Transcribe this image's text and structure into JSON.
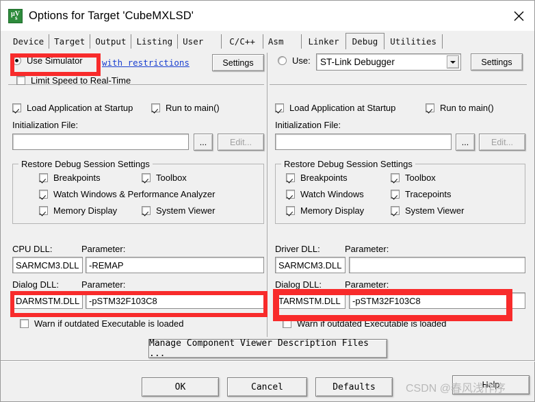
{
  "window": {
    "title": "Options for Target 'CubeMXLSD'",
    "icon": "keil-uvision-icon",
    "close_icon": "close-icon"
  },
  "tabs": [
    {
      "label": "Device",
      "active": false
    },
    {
      "label": "Target",
      "active": false
    },
    {
      "label": "Output",
      "active": false
    },
    {
      "label": "Listing",
      "active": false
    },
    {
      "label": "User",
      "active": false
    },
    {
      "label": "C/C++",
      "active": false
    },
    {
      "label": "Asm",
      "active": false
    },
    {
      "label": "Linker",
      "active": false
    },
    {
      "label": "Debug",
      "active": true
    },
    {
      "label": "Utilities",
      "active": false
    }
  ],
  "left": {
    "use_simulator_label": "Use Simulator",
    "use_simulator_checked": true,
    "with_restrictions_link": "with restrictions",
    "settings_button": "Settings",
    "limit_speed_label": "Limit Speed to Real-Time",
    "limit_speed_checked": false,
    "load_app_label": "Load Application at Startup",
    "load_app_checked": true,
    "run_to_main_label": "Run to main()",
    "run_to_main_checked": true,
    "init_file_label": "Initialization File:",
    "init_file_value": "",
    "browse_button": "...",
    "edit_button": "Edit...",
    "restore_group_title": "Restore Debug Session Settings",
    "restore_items": [
      {
        "label": "Breakpoints",
        "checked": true
      },
      {
        "label": "Toolbox",
        "checked": true
      },
      {
        "label": "Watch Windows & Performance Analyzer",
        "checked": true
      },
      {
        "label": "Memory Display",
        "checked": true
      },
      {
        "label": "System Viewer",
        "checked": true
      }
    ],
    "cpu_dll_label": "CPU DLL:",
    "cpu_parameter_label": "Parameter:",
    "cpu_dll_value": "SARMCM3.DLL",
    "cpu_parameter_value": "-REMAP",
    "dialog_dll_label": "Dialog DLL:",
    "dialog_parameter_label": "Parameter:",
    "dialog_dll_value": "DARMSTM.DLL",
    "dialog_parameter_value": "-pSTM32F103C8",
    "warn_outdated_label": "Warn if outdated Executable is loaded",
    "warn_outdated_checked": false
  },
  "right": {
    "use_label": "Use:",
    "use_checked": false,
    "debugger_selected": "ST-Link Debugger",
    "settings_button": "Settings",
    "load_app_label": "Load Application at Startup",
    "load_app_checked": true,
    "run_to_main_label": "Run to main()",
    "run_to_main_checked": true,
    "init_file_label": "Initialization File:",
    "init_file_value": "",
    "browse_button": "...",
    "edit_button": "Edit...",
    "restore_group_title": "Restore Debug Session Settings",
    "restore_items": [
      {
        "label": "Breakpoints",
        "checked": true
      },
      {
        "label": "Toolbox",
        "checked": true
      },
      {
        "label": "Watch Windows",
        "checked": true
      },
      {
        "label": "Tracepoints",
        "checked": true
      },
      {
        "label": "Memory Display",
        "checked": true
      },
      {
        "label": "System Viewer",
        "checked": true
      }
    ],
    "driver_dll_label": "Driver DLL:",
    "driver_parameter_label": "Parameter:",
    "driver_dll_value": "SARMCM3.DLL",
    "driver_parameter_value": "",
    "dialog_dll_label": "Dialog DLL:",
    "dialog_parameter_label": "Parameter:",
    "dialog_dll_value": "TARMSTM.DLL",
    "dialog_parameter_value": "-pSTM32F103C8",
    "warn_outdated_label": "Warn if outdated Executable is loaded",
    "warn_outdated_checked": false
  },
  "footer": {
    "manage_button": "Manage Component Viewer Description Files ...",
    "ok_button": "OK",
    "cancel_button": "Cancel",
    "defaults_button": "Defaults",
    "help_button": "Help"
  },
  "annotations": {
    "highlight_color": "#f82b2b",
    "boxes": [
      "use-simulator-highlight",
      "left-dialog-dll-highlight",
      "right-dialog-dll-highlight"
    ]
  },
  "watermark": {
    "text": "CSDN @春风浅作序"
  }
}
